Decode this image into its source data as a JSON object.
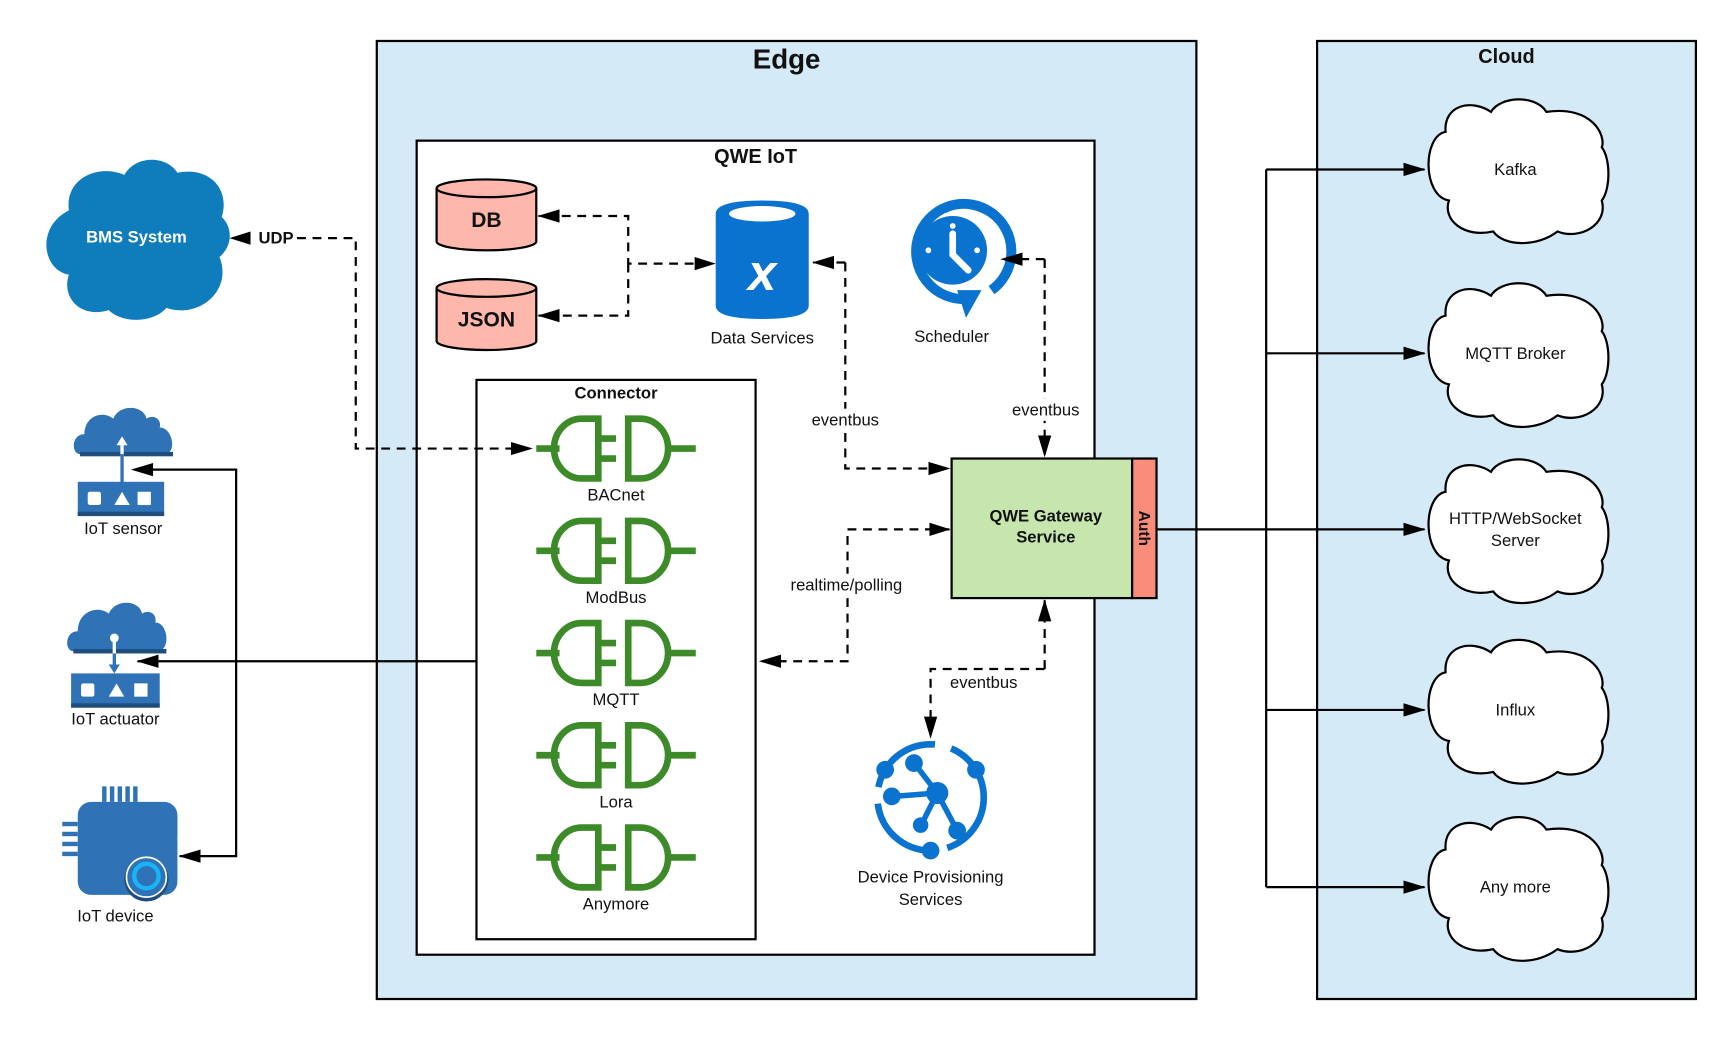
{
  "diagram": {
    "edge": {
      "title": "Edge"
    },
    "cloud": {
      "title": "Cloud",
      "services": [
        {
          "label_lines": [
            "Kafka"
          ]
        },
        {
          "label_lines": [
            "MQTT Broker"
          ]
        },
        {
          "label_lines": [
            "HTTP/WebSocket",
            "Server"
          ]
        },
        {
          "label_lines": [
            "Influx"
          ]
        },
        {
          "label_lines": [
            "Any more"
          ]
        }
      ]
    },
    "qwe_iot": {
      "title": "QWE IoT",
      "db": "DB",
      "json": "JSON",
      "data_services": "Data Services",
      "scheduler": "Scheduler",
      "gateway_lines": [
        "QWE Gateway",
        "Service"
      ],
      "auth": "Auth",
      "device_provisioning_lines": [
        "Device Provisioning",
        "Services"
      ],
      "connector": {
        "title": "Connector",
        "items": [
          "BACnet",
          "ModBus",
          "MQTT",
          "Lora",
          "Anymore"
        ]
      }
    },
    "external": {
      "bms": "BMS System",
      "iot_sensor": "IoT sensor",
      "iot_actuator": "IoT actuator",
      "iot_device": "IoT device"
    },
    "edge_labels": {
      "udp": "UDP",
      "eventbus_data": "eventbus",
      "eventbus_scheduler": "eventbus",
      "realtime": "realtime/polling",
      "eventbus_provisioning": "eventbus"
    },
    "colors": {
      "zone_fill": "#d4eaf7",
      "db_fill": "#fdb8ab",
      "gateway_fill": "#c6e6ad",
      "auth_fill": "#fa8c7a",
      "icon_blue": "#0a72cf",
      "bms_blue": "#0f7dbb",
      "iot_blue": "#2f72b6",
      "plug_green": "#3c8a28"
    }
  }
}
